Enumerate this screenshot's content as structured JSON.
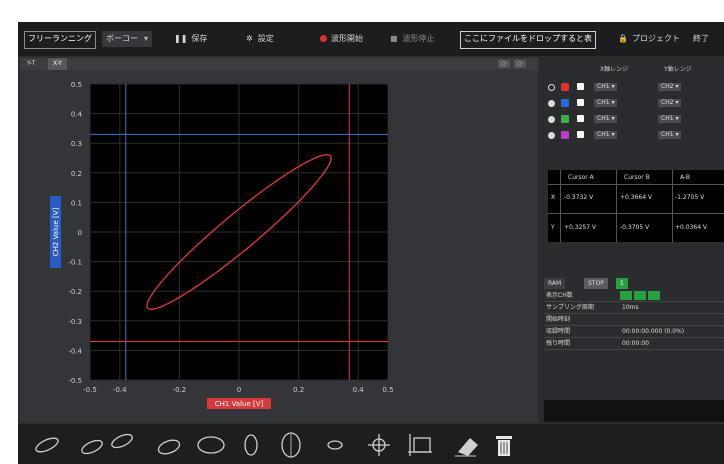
{
  "toolbar": {
    "mode": "フリーランニング",
    "play_button": "ボーコー",
    "save": "保存",
    "settings": "設定",
    "record": "波形開始",
    "stop": "波形停止",
    "dropzone": "ここにファイルをドロップすると表",
    "project": "プロジェクト",
    "exit": "終了"
  },
  "tabs": [
    "Y-T",
    "X-Y"
  ],
  "panel_buttons": [
    "□-",
    "□-"
  ],
  "chart_data": {
    "type": "line",
    "xlabel": "CH1 Value [V]",
    "ylabel": "CH2 Value [V]",
    "xlim": [
      -0.5,
      0.5
    ],
    "ylim": [
      -0.5,
      0.5
    ],
    "x_ticks": [
      "-0.5",
      "-0.4",
      "-0.2",
      "0",
      "0.2",
      "0.4",
      "0.5"
    ],
    "x_tick_values": [
      -0.5,
      -0.4,
      -0.2,
      0,
      0.2,
      0.4,
      0.5
    ],
    "y_ticks": [
      "0.5",
      "0.4",
      "0.3",
      "0.2",
      "0.1",
      "0",
      "-0.1",
      "-0.2",
      "-0.3",
      "-0.4",
      "-0.5"
    ],
    "y_tick_values": [
      0.5,
      0.4,
      0.3,
      0.2,
      0.1,
      0,
      -0.1,
      -0.2,
      -0.3,
      -0.4,
      -0.5
    ],
    "grid": true,
    "series": [
      {
        "color": "#e03a3a",
        "shape": "ellipse",
        "center": [
          0.0,
          0.0
        ],
        "semi_major": 0.4,
        "semi_minor": 0.06,
        "angle_deg": 40
      }
    ],
    "cursor_a": {
      "x": -0.38,
      "y": 0.33,
      "color": "#3a78d8"
    },
    "cursor_b": {
      "x": 0.37,
      "y": -0.37,
      "color": "#e03a3a"
    }
  },
  "channels": {
    "x_header": "X軸レンジ",
    "y_header": "Y軸レンジ",
    "rows": [
      {
        "color": "#e03030",
        "x": "CH1",
        "y": "CH2"
      },
      {
        "color": "#2a6ad6",
        "x": "CH1",
        "y": "CH2"
      },
      {
        "color": "#3cb043",
        "x": "CH1",
        "y": "CH1"
      },
      {
        "color": "#c03ac8",
        "x": "CH1",
        "y": "CH1"
      }
    ]
  },
  "cursor_table": {
    "headers": [
      "Cursor A",
      "Cursor B",
      "A-B"
    ],
    "rows": [
      {
        "label": "X",
        "a": "-0.3732 V",
        "b": "+0.3664 V",
        "ab": "-1.2705 V"
      },
      {
        "label": "Y",
        "a": "+0.3257 V",
        "b": "-0.3705 V",
        "ab": "+0.0364 V"
      }
    ]
  },
  "info": {
    "tabs": [
      "RAM",
      "STOP",
      "1"
    ],
    "rows": [
      {
        "key": "表示CH数",
        "value": ""
      },
      {
        "key": "サンプリング周期",
        "value": "10ms"
      },
      {
        "key": "開始時刻",
        "value": ""
      },
      {
        "key": "収録時間",
        "value": "00:00:00.000 (0.0%)"
      },
      {
        "key": "残り時間",
        "value": "00:00:00"
      }
    ]
  },
  "bottom_icons": [
    "ellipse-icon",
    "ellipse-pair-icon",
    "ellipse-tilt-icon",
    "oval-icon",
    "vertical-oval-icon",
    "tall-oval-icon",
    "small-oval-icon",
    "crosshair-icon",
    "cursor-box-icon",
    "eraser-icon",
    "trash-icon"
  ]
}
